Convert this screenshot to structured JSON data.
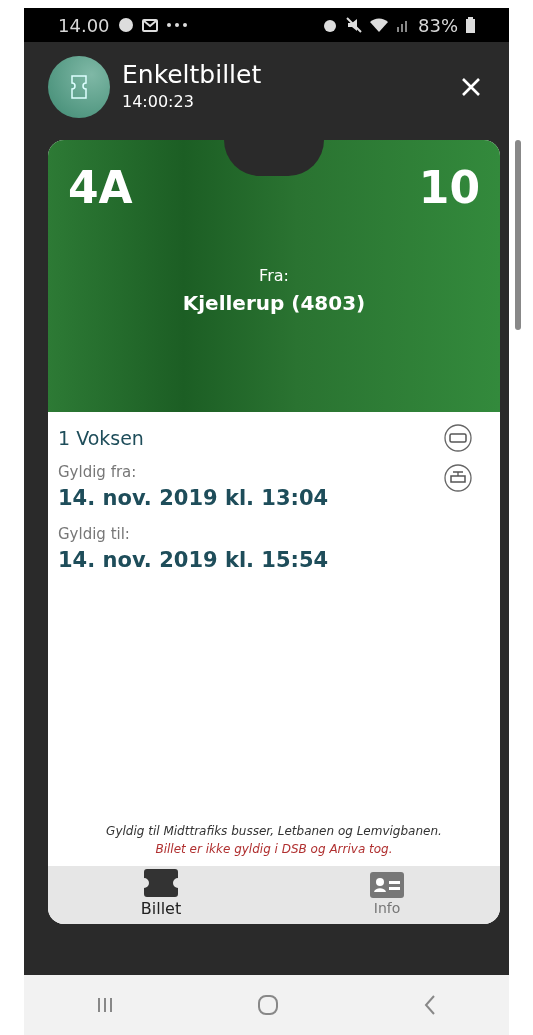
{
  "status_bar": {
    "time": "14.00",
    "battery": "83%"
  },
  "header": {
    "title": "Enkeltbillet",
    "subtitle": "14:00:23"
  },
  "ticket": {
    "zones": "4A",
    "count": "10",
    "from_label": "Fra:",
    "from": "Kjellerup (4803)"
  },
  "details": {
    "passenger": "1 Voksen",
    "valid_from_label": "Gyldig fra:",
    "valid_from": "14. nov. 2019 kl. 13:04",
    "valid_to_label": "Gyldig til:",
    "valid_to": "14. nov. 2019 kl. 15:54"
  },
  "notes": [
    "Gyldig til Midttrafiks busser, Letbanen og Lemvigbanen.",
    "Billet er ikke gyldig i DSB og Arriva tog."
  ],
  "tabs": [
    {
      "label": "Billet",
      "kind": "ticket",
      "selected": true
    },
    {
      "label": "Info",
      "kind": "info",
      "selected": false
    }
  ]
}
